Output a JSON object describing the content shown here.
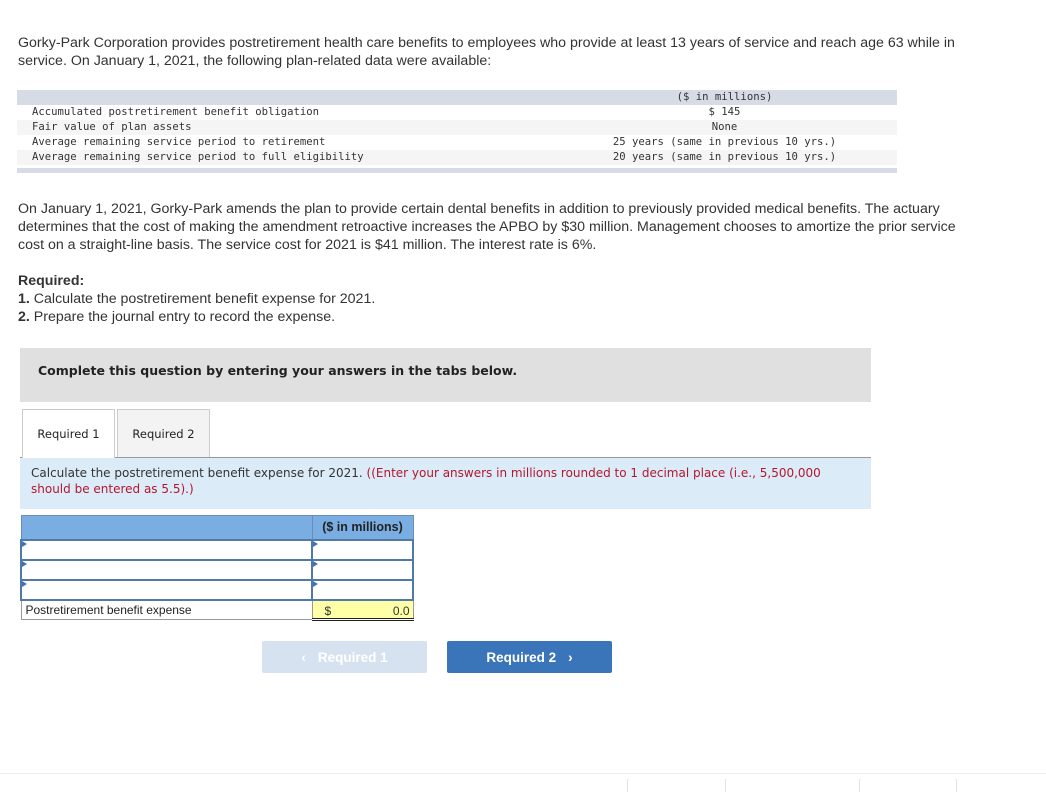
{
  "intro": "Gorky-Park Corporation provides postretirement health care benefits to employees who provide at least 13 years of service and reach age 63 while in service. On January 1, 2021, the following plan-related data were available:",
  "plan_table": {
    "header_value": "($ in millions)",
    "rows": [
      {
        "label": "Accumulated postretirement benefit obligation",
        "value": "$ 145"
      },
      {
        "label": "Fair value of plan assets",
        "value": "None"
      },
      {
        "label": "Average remaining service period to retirement",
        "value": "25 years (same in previous 10 yrs.)"
      },
      {
        "label": "Average remaining service period to full eligibility",
        "value": "20 years (same in previous 10 yrs.)"
      }
    ]
  },
  "paragraph2": "On January 1, 2021, Gorky-Park amends the plan to provide certain dental benefits in addition to previously provided medical benefits. The actuary determines that the cost of making the amendment retroactive increases the APBO by $30 million. Management chooses to amortize the prior service cost on a straight-line basis. The service cost for 2021 is $41 million. The interest rate is 6%.",
  "required": {
    "heading": "Required:",
    "items": [
      {
        "num": "1.",
        "text": " Calculate the postretirement benefit expense for 2021."
      },
      {
        "num": "2.",
        "text": " Prepare the journal entry to record the expense."
      }
    ]
  },
  "banner": "Complete this question by entering your answers in the tabs below.",
  "tabs": [
    {
      "label": "Required 1",
      "active": true
    },
    {
      "label": "Required 2",
      "active": false
    }
  ],
  "instruction": {
    "main": "Calculate the postretirement benefit expense for 2021. ",
    "note": "((Enter your answers in millions rounded to 1 decimal place (i.e., 5,500,000 should be entered as 5.5).)"
  },
  "answer_table": {
    "column_header": "($ in millions)",
    "input_rows": [
      {
        "label_value": "",
        "amount_value": ""
      },
      {
        "label_value": "",
        "amount_value": ""
      },
      {
        "label_value": "",
        "amount_value": ""
      }
    ],
    "total_label": "Postretirement benefit expense",
    "total_currency": "$",
    "total_amount": "0.0"
  },
  "nav": {
    "prev_label": "Required 1",
    "next_label": "Required 2",
    "prev_icon": "‹",
    "next_icon": "›"
  }
}
